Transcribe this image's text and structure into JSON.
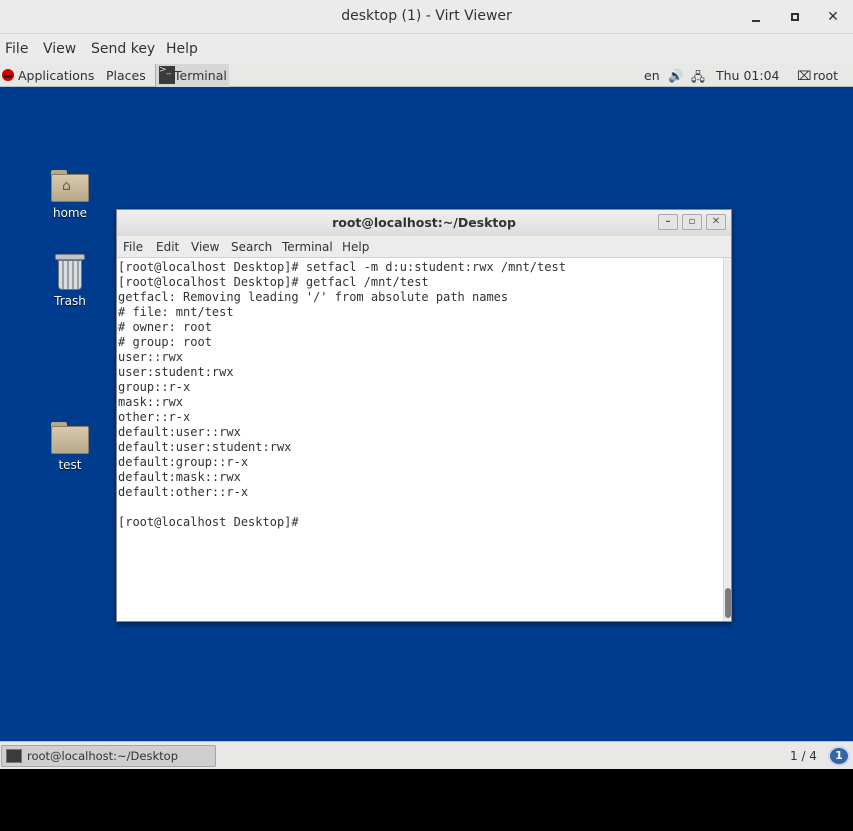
{
  "viewer": {
    "title": "desktop (1) - Virt Viewer",
    "menu": [
      "File",
      "View",
      "Send key",
      "Help"
    ]
  },
  "topbar": {
    "applications": "Applications",
    "places": "Places",
    "terminal": "Terminal",
    "language": "en",
    "clock": "Thu 01:04",
    "user": "root"
  },
  "desktop_icons": [
    {
      "label": "home"
    },
    {
      "label": "Trash"
    },
    {
      "label": "test"
    }
  ],
  "terminal": {
    "title": "root@localhost:~/Desktop",
    "menu": [
      "File",
      "Edit",
      "View",
      "Search",
      "Terminal",
      "Help"
    ],
    "output": "[root@localhost Desktop]# setfacl -m d:u:student:rwx /mnt/test\n[root@localhost Desktop]# getfacl /mnt/test\ngetfacl: Removing leading '/' from absolute path names\n# file: mnt/test\n# owner: root\n# group: root\nuser::rwx\nuser:student:rwx\ngroup::r-x\nmask::rwx\nother::r-x\ndefault:user::rwx\ndefault:user:student:rwx\ndefault:group::r-x\ndefault:mask::rwx\ndefault:other::r-x\n\n[root@localhost Desktop]#"
  },
  "taskbar": {
    "window_label": "root@localhost:~/Desktop",
    "workspace": "1 / 4",
    "notification_count": "1"
  },
  "colors": {
    "desktop_bg": "#003c8e",
    "panel_bg": "#e8e8e7"
  }
}
